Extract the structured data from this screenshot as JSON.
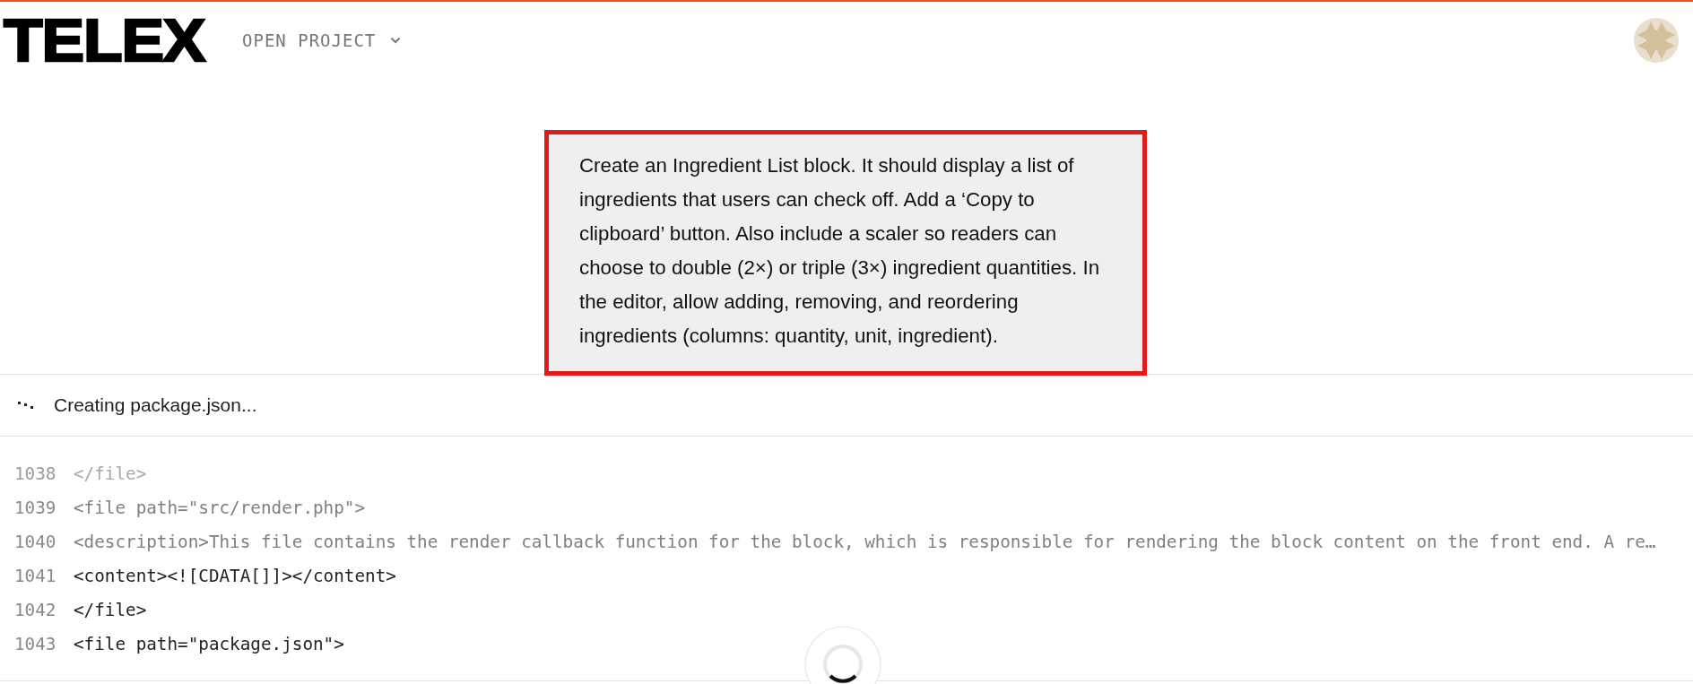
{
  "header": {
    "logo": "TELEX",
    "project_menu": {
      "label": "OPEN PROJECT"
    }
  },
  "prompt": {
    "text": "Create an Ingredient List block. It should display a list of ingredients that users can check off. Add a ‘Copy to clipboard’ button. Also include a scaler so readers can choose to double (2×) or triple (3×) ingredient quantities. In the editor, allow adding, removing, and reordering ingredients (columns: quantity, unit, ingredient)."
  },
  "status": {
    "text": "Creating package.json..."
  },
  "code_lines": [
    {
      "number": "1038",
      "text": "</file>",
      "kind": "faint"
    },
    {
      "number": "1039",
      "text": "<file path=\"src/render.php\">",
      "kind": "dim"
    },
    {
      "number": "1040",
      "text": "<description>This file contains the render callback function for the block, which is responsible for rendering the block content on the front end. A re…",
      "kind": "dim"
    },
    {
      "number": "1041",
      "text": "<content><![CDATA[]]></content>",
      "kind": "normal"
    },
    {
      "number": "1042",
      "text": "</file>",
      "kind": "normal"
    },
    {
      "number": "1043",
      "text": "<file path=\"package.json\">",
      "kind": "normal"
    }
  ]
}
